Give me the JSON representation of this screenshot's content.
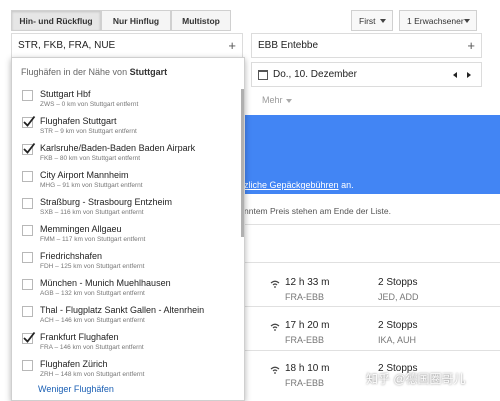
{
  "trip_types": [
    "Hin- und Rückflug",
    "Nur Hinflug",
    "Multistop"
  ],
  "cabin_class": "First",
  "passengers": "1 Erwachsener",
  "origin": {
    "value": "STR, FKB, FRA, NUE",
    "plus": "+"
  },
  "destination": {
    "value": "EBB Entebbe",
    "plus": "+"
  },
  "date": {
    "value": "Do., 10. Dezember"
  },
  "filters": {
    "more": "Mehr"
  },
  "banner": {
    "text_link": "sätzliche Gepäckgebühren",
    "text_after": " an."
  },
  "note": "nntem Preis stehen am Ende der Liste.",
  "dropdown": {
    "header_prefix": "Flughäfen in der Nähe von ",
    "header_city": "Stuttgart",
    "items": [
      {
        "name": "Stuttgart Hbf",
        "sub": "ZWS – 0 km von Stuttgart entfernt",
        "checked": false
      },
      {
        "name": "Flughafen Stuttgart",
        "sub": "STR – 9 km von Stuttgart entfernt",
        "checked": true
      },
      {
        "name": "Karlsruhe/Baden-Baden Baden Airpark",
        "sub": "FKB – 80 km von Stuttgart entfernt",
        "checked": true
      },
      {
        "name": "City Airport Mannheim",
        "sub": "MHG – 91 km von Stuttgart entfernt",
        "checked": false
      },
      {
        "name": "Straßburg - Strasbourg Entzheim",
        "sub": "SXB – 116 km von Stuttgart entfernt",
        "checked": false
      },
      {
        "name": "Memmingen Allgaeu",
        "sub": "FMM – 117 km von Stuttgart entfernt",
        "checked": false
      },
      {
        "name": "Friedrichshafen",
        "sub": "FDH – 125 km von Stuttgart entfernt",
        "checked": false
      },
      {
        "name": "München - Munich Muehlhausen",
        "sub": "AGB – 132 km von Stuttgart entfernt",
        "checked": false
      },
      {
        "name": "Thal - Flugplatz Sankt Gallen - Altenrhein",
        "sub": "ACH – 146 km von Stuttgart entfernt",
        "checked": false
      },
      {
        "name": "Frankfurt Flughafen",
        "sub": "FRA – 146 km von Stuttgart entfernt",
        "checked": true
      },
      {
        "name": "Flughafen Zürich",
        "sub": "ZRH – 148 km von Stuttgart entfernt",
        "checked": false
      }
    ],
    "footer": "Weniger Flughäfen"
  },
  "flights": [
    {
      "duration": "12 h 33 m",
      "route": "FRA-EBB",
      "stops": "2 Stopps",
      "via": "JED, ADD"
    },
    {
      "duration": "17 h 20 m",
      "route": "FRA-EBB",
      "stops": "2 Stopps",
      "via": "IKA, AUH"
    },
    {
      "duration": "18 h 10 m",
      "route": "FRA-EBB",
      "stops": "2 Stopps",
      "via": ""
    }
  ],
  "watermark": "知乎 @德国圈哥儿",
  "colors": {
    "banner": "#4285f4",
    "link": "#1a5fb4"
  }
}
